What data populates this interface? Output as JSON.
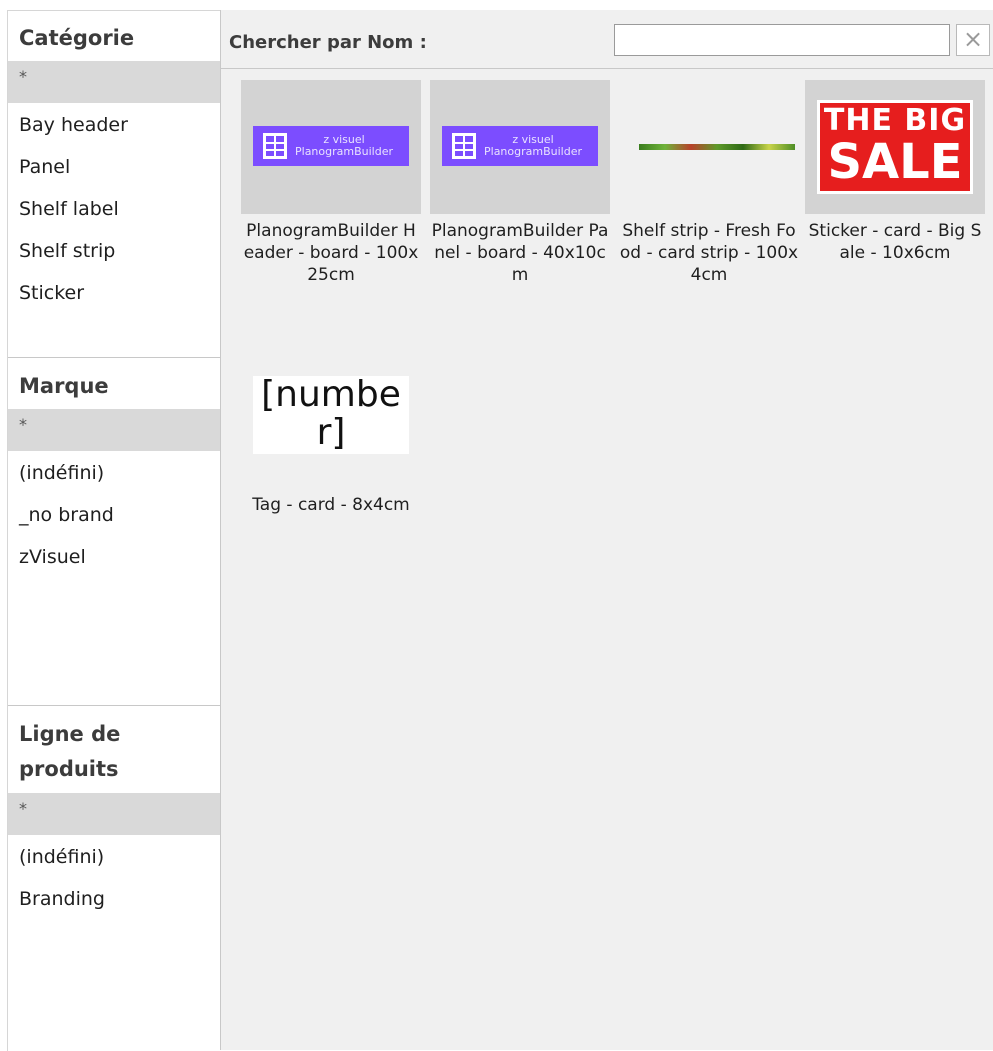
{
  "sidebar": {
    "categorie": {
      "title": "Catégorie",
      "selected": "*",
      "items": [
        "Bay header",
        "Panel",
        "Shelf label",
        "Shelf strip",
        "Sticker"
      ]
    },
    "marque": {
      "title": "Marque",
      "selected": "*",
      "items": [
        "(indéfini)",
        "_no brand",
        "zVisuel"
      ]
    },
    "ligne": {
      "title_line1": "Ligne de",
      "title_line2": "produits",
      "selected": "*",
      "items": [
        "(indéfini)",
        "Branding"
      ]
    }
  },
  "search": {
    "label": "Chercher par Nom :",
    "value": "",
    "clear_glyph": "×"
  },
  "products": [
    {
      "label": "PlanogramBuilder Header - board - 100x25cm",
      "thumb_brand": "z visuel",
      "thumb_name": "PlanogramBuilder"
    },
    {
      "label": "PlanogramBuilder Panel - board - 40x10cm",
      "thumb_brand": "z visuel",
      "thumb_name": "PlanogramBuilder"
    },
    {
      "label": "Shelf strip - Fresh Food - card strip - 100x4cm"
    },
    {
      "label": "Sticker - card - Big Sale - 10x6cm",
      "thumb_line1": "THE BIG",
      "thumb_line2": "SALE"
    },
    {
      "label": "Tag - card - 8x4cm",
      "thumb_text": "[number]"
    }
  ]
}
